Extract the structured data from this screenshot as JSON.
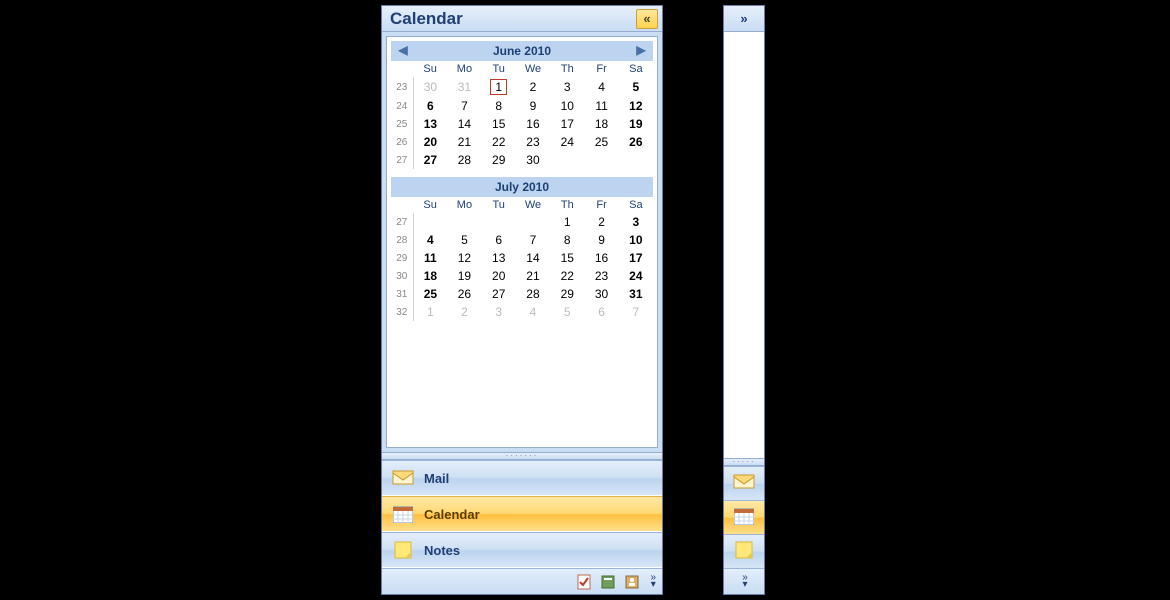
{
  "header": {
    "title": "Calendar"
  },
  "day_headers": [
    "Su",
    "Mo",
    "Tu",
    "We",
    "Th",
    "Fr",
    "Sa"
  ],
  "months": [
    {
      "label": "June  2010",
      "nav": true,
      "weeks": [
        {
          "wk": 23,
          "days": [
            {
              "n": 30,
              "dim": true
            },
            {
              "n": 31,
              "dim": true
            },
            {
              "n": 1,
              "today": true
            },
            {
              "n": 2
            },
            {
              "n": 3
            },
            {
              "n": 4
            },
            {
              "n": 5,
              "bold": true
            }
          ]
        },
        {
          "wk": 24,
          "days": [
            {
              "n": 6,
              "bold": true
            },
            {
              "n": 7
            },
            {
              "n": 8
            },
            {
              "n": 9
            },
            {
              "n": 10
            },
            {
              "n": 11
            },
            {
              "n": 12,
              "bold": true
            }
          ]
        },
        {
          "wk": 25,
          "days": [
            {
              "n": 13,
              "bold": true
            },
            {
              "n": 14
            },
            {
              "n": 15
            },
            {
              "n": 16
            },
            {
              "n": 17
            },
            {
              "n": 18
            },
            {
              "n": 19,
              "bold": true
            }
          ]
        },
        {
          "wk": 26,
          "days": [
            {
              "n": 20,
              "bold": true
            },
            {
              "n": 21
            },
            {
              "n": 22
            },
            {
              "n": 23
            },
            {
              "n": 24
            },
            {
              "n": 25
            },
            {
              "n": 26,
              "bold": true
            }
          ]
        },
        {
          "wk": 27,
          "days": [
            {
              "n": 27,
              "bold": true
            },
            {
              "n": 28
            },
            {
              "n": 29
            },
            {
              "n": 30
            },
            {
              "n": "",
              "dim": true
            },
            {
              "n": "",
              "dim": true
            },
            {
              "n": "",
              "dim": true
            }
          ]
        }
      ]
    },
    {
      "label": "July  2010",
      "nav": false,
      "weeks": [
        {
          "wk": 27,
          "days": [
            {
              "n": "",
              "dim": true
            },
            {
              "n": "",
              "dim": true
            },
            {
              "n": "",
              "dim": true
            },
            {
              "n": "",
              "dim": true
            },
            {
              "n": 1
            },
            {
              "n": 2
            },
            {
              "n": 3,
              "bold": true
            }
          ]
        },
        {
          "wk": 28,
          "days": [
            {
              "n": 4,
              "bold": true
            },
            {
              "n": 5
            },
            {
              "n": 6
            },
            {
              "n": 7
            },
            {
              "n": 8
            },
            {
              "n": 9
            },
            {
              "n": 10,
              "bold": true
            }
          ]
        },
        {
          "wk": 29,
          "days": [
            {
              "n": 11,
              "bold": true
            },
            {
              "n": 12
            },
            {
              "n": 13
            },
            {
              "n": 14
            },
            {
              "n": 15
            },
            {
              "n": 16
            },
            {
              "n": 17,
              "bold": true
            }
          ]
        },
        {
          "wk": 30,
          "days": [
            {
              "n": 18,
              "bold": true
            },
            {
              "n": 19
            },
            {
              "n": 20
            },
            {
              "n": 21
            },
            {
              "n": 22
            },
            {
              "n": 23
            },
            {
              "n": 24,
              "bold": true
            }
          ]
        },
        {
          "wk": 31,
          "days": [
            {
              "n": 25,
              "bold": true
            },
            {
              "n": 26
            },
            {
              "n": 27
            },
            {
              "n": 28
            },
            {
              "n": 29
            },
            {
              "n": 30
            },
            {
              "n": 31,
              "bold": true
            }
          ]
        },
        {
          "wk": 32,
          "days": [
            {
              "n": 1,
              "dim": true
            },
            {
              "n": 2,
              "dim": true
            },
            {
              "n": 3,
              "dim": true
            },
            {
              "n": 4,
              "dim": true
            },
            {
              "n": 5,
              "dim": true
            },
            {
              "n": 6,
              "dim": true
            },
            {
              "n": 7,
              "dim": true
            }
          ]
        }
      ]
    }
  ],
  "nav": {
    "items": [
      {
        "id": "mail",
        "label": "Mail",
        "active": false,
        "icon": "mail"
      },
      {
        "id": "calendar",
        "label": "Calendar",
        "active": true,
        "icon": "calendar"
      },
      {
        "id": "notes",
        "label": "Notes",
        "active": false,
        "icon": "notes"
      }
    ]
  },
  "overflow_icons": [
    "tasks-icon",
    "journal-icon",
    "contacts-icon"
  ]
}
